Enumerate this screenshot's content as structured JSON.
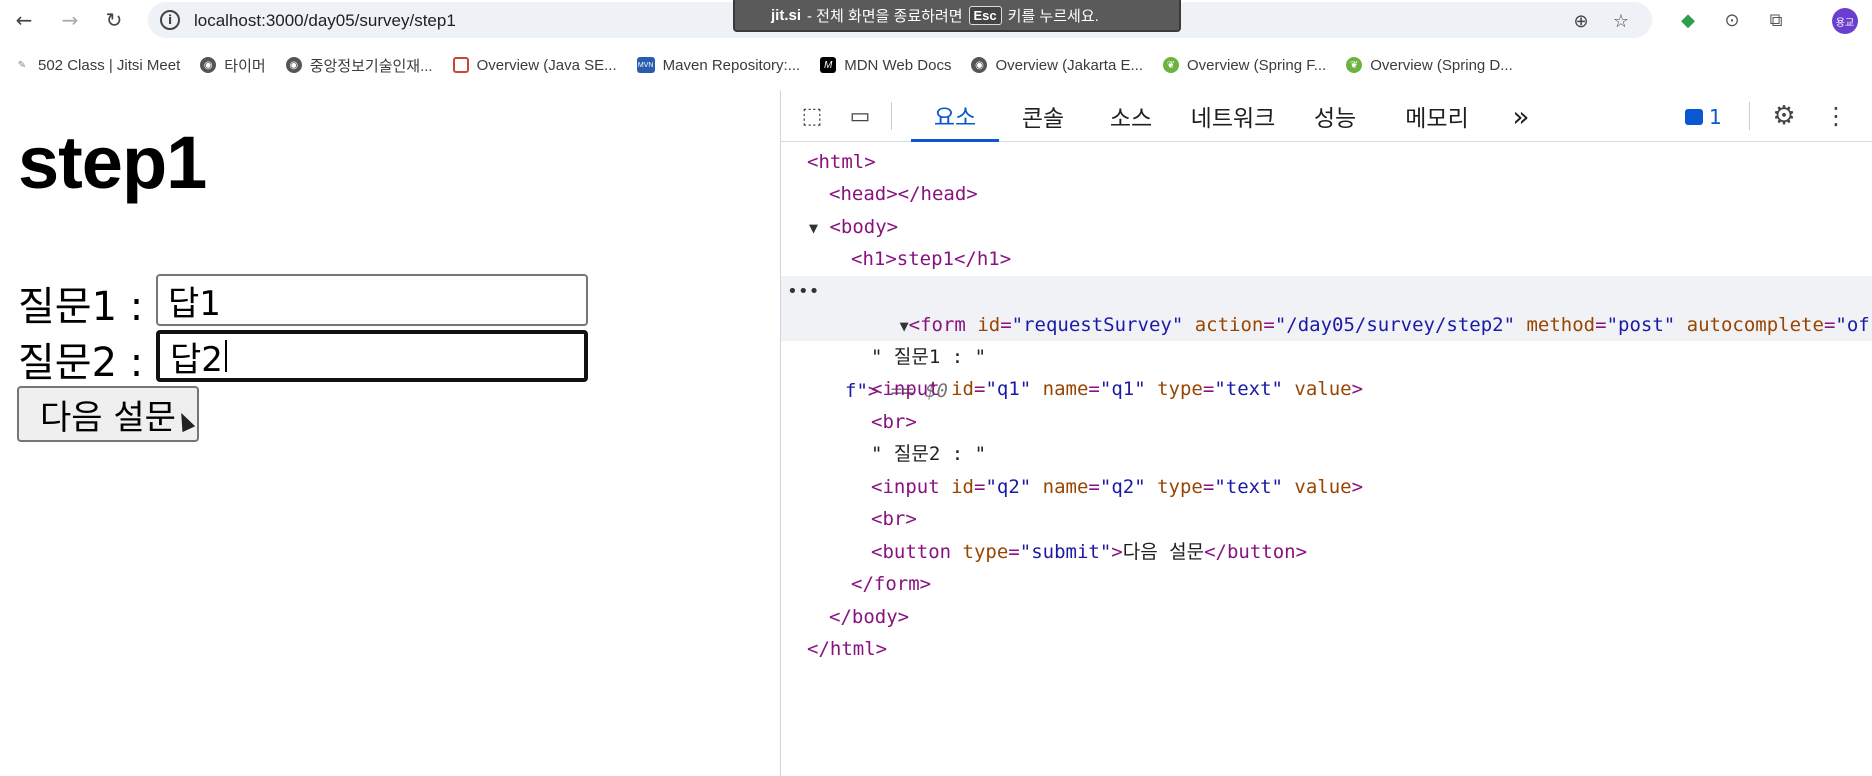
{
  "browser": {
    "url": "localhost:3000/day05/survey/step1",
    "toast": {
      "brand": "jit.si",
      "message": "- 전체 화면을 종료하려면",
      "key": "Esc",
      "suffix": "키를 누르세요."
    },
    "bookmarks": [
      {
        "label": "502 Class | Jitsi Meet",
        "icon": "jitsi-icon",
        "color": "#888888"
      },
      {
        "label": "타이머",
        "icon": "globe-icon",
        "color": "#555555"
      },
      {
        "label": "중앙정보기술인재...",
        "icon": "globe-icon",
        "color": "#555555"
      },
      {
        "label": "Overview (Java SE...",
        "icon": "oracle-icon",
        "color": "#c74634"
      },
      {
        "label": "Maven Repository:...",
        "icon": "maven-icon",
        "color": "#2a5db0"
      },
      {
        "label": "MDN Web Docs",
        "icon": "mdn-icon",
        "color": "#000000"
      },
      {
        "label": "Overview (Jakarta E...",
        "icon": "globe-icon",
        "color": "#555555"
      },
      {
        "label": "Overview (Spring F...",
        "icon": "spring-icon",
        "color": "#6db33f"
      },
      {
        "label": "Overview (Spring D...",
        "icon": "spring-icon",
        "color": "#6db33f"
      }
    ],
    "avatar": "용교"
  },
  "page": {
    "heading": "step1",
    "q1_label": "질문1 :",
    "q1_value": "답1",
    "q2_label": "질문2 :",
    "q2_value": "답2",
    "submit_label": "다음 설문"
  },
  "devtools": {
    "tabs": [
      "요소",
      "콘솔",
      "소스",
      "네트워크",
      "성능",
      "메모리"
    ],
    "active_tab": "요소",
    "more": "»",
    "issues_count": "1",
    "dom": {
      "l1": "<html>",
      "l2": "<head></head>",
      "l3": "<body>",
      "l4": "<h1>step1</h1>",
      "form_open_tag": "<form",
      "form_id_attr": "id",
      "form_id_val": "\"requestSurvey\"",
      "form_action_attr": "action",
      "form_action_val": "\"/day05/survey/step2\"",
      "form_method_attr": "method",
      "form_method_val": "\"post\"",
      "form_ac_attr": "autocomplete",
      "form_ac_val": "\"of",
      "form_ac_val_cont": "f\"",
      "form_close_bracket": ">",
      "selected_marker": "== $0",
      "text1": "\" 질문1 : \"",
      "input1_tag": "<input",
      "input1_id": "\"q1\"",
      "input1_name": "\"q1\"",
      "input_type": "\"text\"",
      "attr_value": "value",
      "br": "<br>",
      "text2": "\" 질문2 : \"",
      "input2_id": "\"q2\"",
      "input2_name": "\"q2\"",
      "button_open": "<button",
      "button_type": "\"submit\"",
      "button_text": "다음 설문",
      "button_close": "</button>",
      "form_close": "</form>",
      "body_close": "</body>",
      "html_close": "</html>",
      "attr_id": "id",
      "attr_name": "name",
      "attr_type": "type"
    }
  }
}
